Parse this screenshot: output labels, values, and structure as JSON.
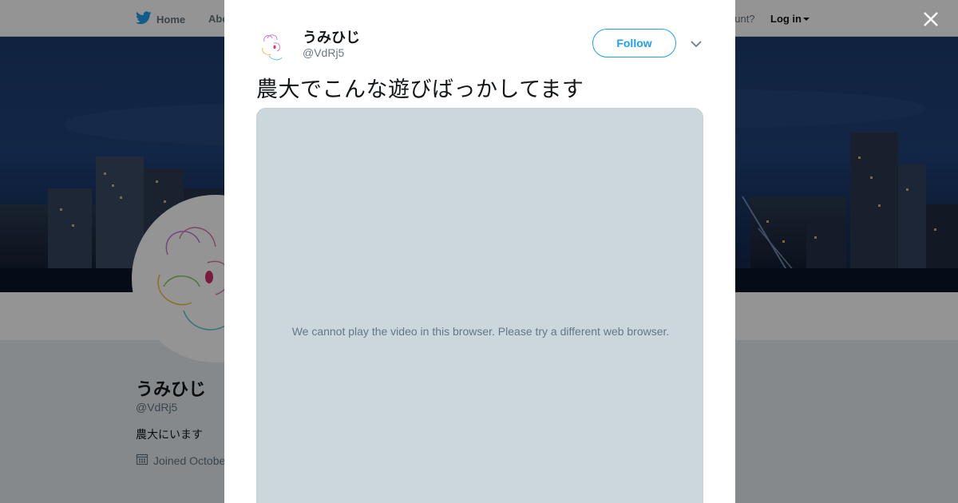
{
  "page": {
    "nav": {
      "home_label": "Home",
      "about_label": "Abo",
      "account_text": "ccount?",
      "login_label": "Log in"
    },
    "profile": {
      "display_name": "うみひじ",
      "handle": "@VdRj5",
      "bio": "農大にいます",
      "joined": "Joined Octobe"
    }
  },
  "modal": {
    "tweet": {
      "display_name": "うみひじ",
      "handle": "@VdRj5",
      "follow_label": "Follow",
      "text": "農大でこんな遊びばっかしてます",
      "video_message": "We cannot play the video in this browser. Please try a different web browser."
    }
  },
  "colors": {
    "accent": "#1da1f2",
    "text_primary": "#14171a",
    "text_secondary": "#657786",
    "video_placeholder": "#ccd6dd"
  },
  "icons": {
    "brand": "twitter-bird-icon",
    "close": "close-icon",
    "more": "chevron-down-icon",
    "calendar": "calendar-icon"
  }
}
